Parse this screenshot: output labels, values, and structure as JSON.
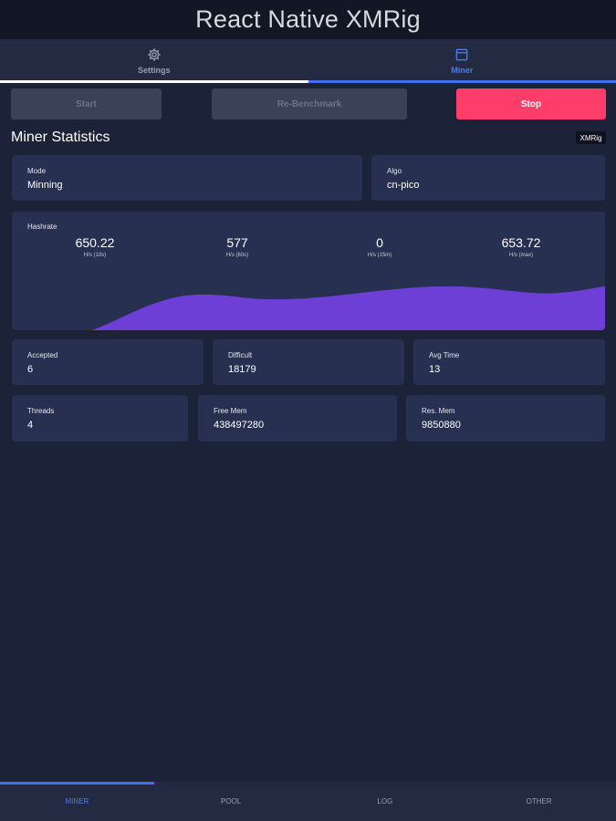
{
  "app": {
    "title": "React Native XMRig"
  },
  "top_tabs": [
    {
      "label": "Settings",
      "icon": "gear-icon",
      "active": false
    },
    {
      "label": "Miner",
      "icon": "window-icon",
      "active": true
    }
  ],
  "actions": {
    "start_label": "Start",
    "rebench_label": "Re-Benchmark",
    "stop_label": "Stop"
  },
  "section": {
    "title": "Miner Statistics",
    "badge": "XMRig"
  },
  "mode": {
    "label": "Mode",
    "value": "Minning"
  },
  "algo": {
    "label": "Algo",
    "value": "cn-pico"
  },
  "hashrate": {
    "label": "Hashrate",
    "stats": [
      {
        "value": "650.22",
        "unit": "H/s (10s)"
      },
      {
        "value": "577",
        "unit": "H/s (60s)"
      },
      {
        "value": "0",
        "unit": "H/s (15m)"
      },
      {
        "value": "653.72",
        "unit": "H/s (max)"
      }
    ],
    "area_color": "#6e3fd6"
  },
  "accepted": {
    "label": "Accepted",
    "value": "6"
  },
  "difficult": {
    "label": "Difficult",
    "value": "18179"
  },
  "avg_time": {
    "label": "Avg Time",
    "value": "13"
  },
  "threads": {
    "label": "Threads",
    "value": "4"
  },
  "free_mem": {
    "label": "Free Mem",
    "value": "438497280"
  },
  "res_mem": {
    "label": "Res. Mem",
    "value": "9850880"
  },
  "bottom_nav": [
    {
      "label": "MINER",
      "active": true
    },
    {
      "label": "POOL",
      "active": false
    },
    {
      "label": "LOG",
      "active": false
    },
    {
      "label": "OTHER",
      "active": false
    }
  ],
  "colors": {
    "background": "#1c2237",
    "card": "#273050",
    "accent": "#3d6ff0",
    "stop": "#ff3d6b",
    "chart": "#6e3fd6"
  }
}
